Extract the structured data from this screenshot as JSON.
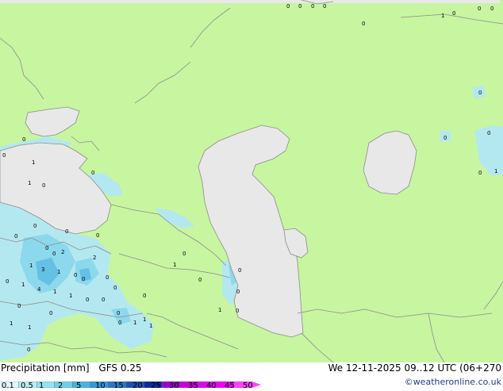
{
  "header": {
    "title": "Precipitation [mm]",
    "model": "GFS 0.25",
    "valid": "We 12-11-2025 09..12 UTC (06+270",
    "credit": "©weatheronline.co.uk"
  },
  "legend": {
    "ticks": [
      "0.1",
      "0.5",
      "1",
      "2",
      "5",
      "10",
      "15",
      "20",
      "25",
      "30",
      "35",
      "40",
      "45",
      "50"
    ],
    "colors": [
      "#e0f8fa",
      "#b8eef4",
      "#96e2f0",
      "#6ed0e8",
      "#46b4e0",
      "#3296dc",
      "#2878c8",
      "#1e50b4",
      "#1028a0",
      "#a000c8",
      "#c800dc",
      "#e000f0",
      "#f000f8",
      "#ff40ff"
    ]
  },
  "colors": {
    "land": "#c8f5a0",
    "water": "#e8e8e8",
    "border": "#8c8c8c",
    "precip_light": "#b4e8f0",
    "precip_mid": "#8cd8ec",
    "precip_heavy": "#64c0e4"
  },
  "map_values": [
    {
      "id": "v1",
      "text": "0"
    },
    {
      "id": "v2",
      "text": "0"
    },
    {
      "id": "v3",
      "text": "0"
    },
    {
      "id": "v4",
      "text": "0"
    },
    {
      "id": "v5",
      "text": "1"
    },
    {
      "id": "v6",
      "text": "0"
    },
    {
      "id": "v7",
      "text": "0"
    },
    {
      "id": "v8",
      "text": "0"
    },
    {
      "id": "v9",
      "text": "0"
    },
    {
      "id": "v10",
      "text": "0"
    },
    {
      "id": "v11",
      "text": "0"
    },
    {
      "id": "v12",
      "text": "0"
    },
    {
      "id": "v13",
      "text": "0"
    },
    {
      "id": "v14",
      "text": "1"
    },
    {
      "id": "v15",
      "text": "0"
    },
    {
      "id": "v16",
      "text": "0"
    },
    {
      "id": "v17",
      "text": "1"
    },
    {
      "id": "v18",
      "text": "0"
    },
    {
      "id": "v19",
      "text": "1"
    },
    {
      "id": "v20",
      "text": "0"
    },
    {
      "id": "v21",
      "text": "2"
    },
    {
      "id": "v22",
      "text": "2"
    },
    {
      "id": "v23",
      "text": "0"
    },
    {
      "id": "v24",
      "text": "3"
    },
    {
      "id": "v25",
      "text": "1"
    },
    {
      "id": "v26",
      "text": "0"
    },
    {
      "id": "v27",
      "text": "1"
    },
    {
      "id": "v28",
      "text": "0"
    },
    {
      "id": "v29",
      "text": "0"
    },
    {
      "id": "v30",
      "text": "1"
    },
    {
      "id": "v31",
      "text": "4"
    },
    {
      "id": "v32",
      "text": "1"
    },
    {
      "id": "v33",
      "text": "1"
    },
    {
      "id": "v34",
      "text": "0"
    },
    {
      "id": "v35",
      "text": "0"
    },
    {
      "id": "v36",
      "text": "0"
    },
    {
      "id": "v37",
      "text": "0"
    },
    {
      "id": "v38",
      "text": "1"
    },
    {
      "id": "v39",
      "text": "0"
    },
    {
      "id": "v40",
      "text": "0"
    },
    {
      "id": "v41",
      "text": "1"
    },
    {
      "id": "v42",
      "text": "1"
    },
    {
      "id": "v43",
      "text": "0"
    },
    {
      "id": "v44",
      "text": "0"
    },
    {
      "id": "v45",
      "text": "0"
    },
    {
      "id": "v46",
      "text": "0"
    },
    {
      "id": "v47",
      "text": "0"
    },
    {
      "id": "v48",
      "text": "0"
    },
    {
      "id": "v49",
      "text": "1"
    },
    {
      "id": "v50",
      "text": "0"
    },
    {
      "id": "v51",
      "text": "0"
    },
    {
      "id": "v52",
      "text": "1"
    },
    {
      "id": "v53",
      "text": "0"
    },
    {
      "id": "v54",
      "text": "0"
    },
    {
      "id": "v55",
      "text": "0"
    },
    {
      "id": "v56",
      "text": "0"
    },
    {
      "id": "v57",
      "text": "0"
    },
    {
      "id": "v58",
      "text": "0"
    },
    {
      "id": "v59",
      "text": "1"
    },
    {
      "id": "v60",
      "text": "1"
    }
  ]
}
